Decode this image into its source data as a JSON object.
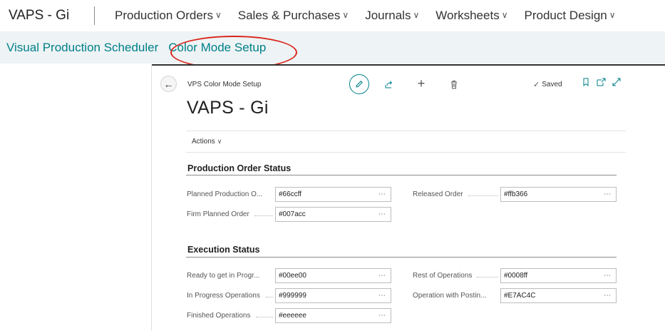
{
  "header": {
    "app_title": "VAPS - Gi",
    "nav": [
      {
        "label": "Production Orders"
      },
      {
        "label": "Sales & Purchases"
      },
      {
        "label": "Journals"
      },
      {
        "label": "Worksheets"
      },
      {
        "label": "Product Design"
      }
    ]
  },
  "subnav": {
    "items": [
      {
        "label": "Visual Production Scheduler"
      },
      {
        "label": "Color Mode Setup"
      }
    ]
  },
  "card": {
    "caption": "VPS Color Mode Setup",
    "title": "VAPS - Gi",
    "saved_label": "Saved",
    "actions_label": "Actions",
    "sections": [
      {
        "title": "Production Order Status",
        "fields": [
          {
            "label": "Planned Production O...",
            "value": "#66ccff"
          },
          {
            "label": "Released Order",
            "value": "#ffb366"
          },
          {
            "label": "Firm Planned Order",
            "value": "#007acc"
          }
        ]
      },
      {
        "title": "Execution Status",
        "fields": [
          {
            "label": "Ready to get in Progr...",
            "value": "#00ee00"
          },
          {
            "label": "Rest of Operations",
            "value": "#0008ff"
          },
          {
            "label": "In Progress Operations",
            "value": "#999999"
          },
          {
            "label": "Operation with Postin...",
            "value": "#E7AC4C"
          },
          {
            "label": "Finished Operations",
            "value": "#eeeeee"
          }
        ]
      }
    ]
  },
  "colors": {
    "accent": "#00808a",
    "highlight": "#d9261c",
    "subbar_bg": "#eef3f5"
  }
}
